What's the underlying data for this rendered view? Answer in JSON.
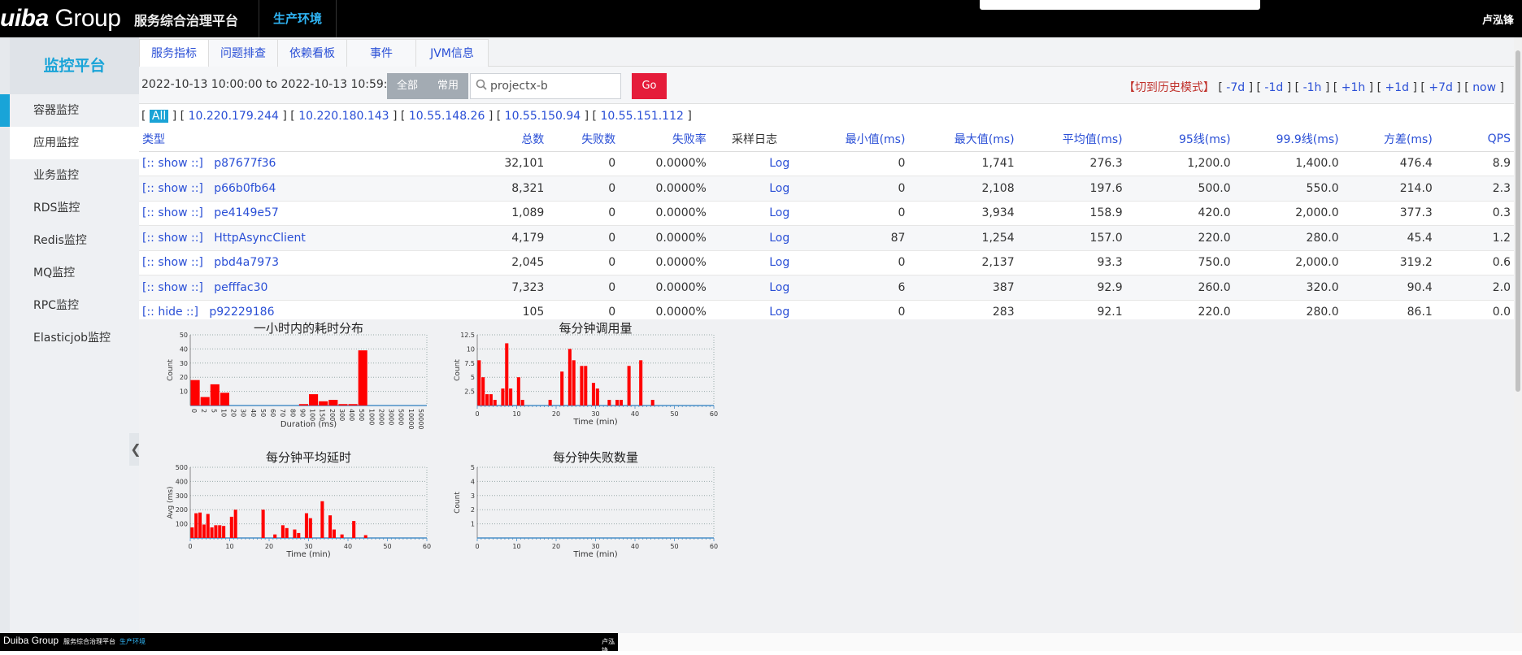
{
  "topbar": {
    "brand_prefix": "uiba",
    "brand_suffix": " Group",
    "app_title": "服务综合治理平台",
    "env_tab": "生产环境",
    "user": "卢泓锋"
  },
  "sidebar": {
    "title": "监控平台",
    "items": [
      {
        "label": "容器监控"
      },
      {
        "label": "应用监控",
        "active": true
      },
      {
        "label": "业务监控"
      },
      {
        "label": "RDS监控"
      },
      {
        "label": "Redis监控"
      },
      {
        "label": "MQ监控"
      },
      {
        "label": "RPC监控"
      },
      {
        "label": "Elasticjob监控"
      }
    ]
  },
  "tabs": [
    {
      "label": "服务指标",
      "active": true
    },
    {
      "label": "问题排查"
    },
    {
      "label": "依赖看板"
    },
    {
      "label": "事件"
    },
    {
      "label": "JVM信息"
    }
  ],
  "toolbar": {
    "time_range": "2022-10-13 10:00:00 to 2022-10-13 10:59:59",
    "seg_all": "全部",
    "seg_common": "常用",
    "search_value": "projectx-b",
    "go_label": "Go",
    "history_mode": "【切到历史模式】",
    "nav": [
      "-7d",
      "-1d",
      "-1h",
      "+1h",
      "+1d",
      "+7d",
      "now"
    ]
  },
  "ip_bar": {
    "all_label": "All",
    "ips": [
      "10.220.179.244",
      "10.220.180.143",
      "10.55.148.26",
      "10.55.150.94",
      "10.55.151.112"
    ]
  },
  "table": {
    "headers": [
      "类型",
      "总数",
      "失败数",
      "失败率",
      "采样日志",
      "最小值(ms)",
      "最大值(ms)",
      "平均值(ms)",
      "95线(ms)",
      "99.9线(ms)",
      "方差(ms)",
      "QPS"
    ],
    "rows": [
      {
        "toggle": "[:: show ::]",
        "name": "p87677f36",
        "total": "32,101",
        "fail": "0",
        "rate": "0.0000%",
        "log": "Log",
        "min": "0",
        "max": "1,741",
        "avg": "276.3",
        "p95": "1,200.0",
        "p999": "1,400.0",
        "std": "476.4",
        "qps": "8.9"
      },
      {
        "toggle": "[:: show ::]",
        "name": "p66b0fb64",
        "total": "8,321",
        "fail": "0",
        "rate": "0.0000%",
        "log": "Log",
        "min": "0",
        "max": "2,108",
        "avg": "197.6",
        "p95": "500.0",
        "p999": "550.0",
        "std": "214.0",
        "qps": "2.3"
      },
      {
        "toggle": "[:: show ::]",
        "name": "pe4149e57",
        "total": "1,089",
        "fail": "0",
        "rate": "0.0000%",
        "log": "Log",
        "min": "0",
        "max": "3,934",
        "avg": "158.9",
        "p95": "420.0",
        "p999": "2,000.0",
        "std": "377.3",
        "qps": "0.3"
      },
      {
        "toggle": "[:: show ::]",
        "name": "HttpAsyncClient",
        "total": "4,179",
        "fail": "0",
        "rate": "0.0000%",
        "log": "Log",
        "min": "87",
        "max": "1,254",
        "avg": "157.0",
        "p95": "220.0",
        "p999": "280.0",
        "std": "45.4",
        "qps": "1.2"
      },
      {
        "toggle": "[:: show ::]",
        "name": "pbd4a7973",
        "total": "2,045",
        "fail": "0",
        "rate": "0.0000%",
        "log": "Log",
        "min": "0",
        "max": "2,137",
        "avg": "93.3",
        "p95": "750.0",
        "p999": "2,000.0",
        "std": "319.2",
        "qps": "0.6"
      },
      {
        "toggle": "[:: show ::]",
        "name": "pefffac30",
        "total": "7,323",
        "fail": "0",
        "rate": "0.0000%",
        "log": "Log",
        "min": "6",
        "max": "387",
        "avg": "92.9",
        "p95": "260.0",
        "p999": "320.0",
        "std": "90.4",
        "qps": "2.0"
      },
      {
        "toggle": "[:: hide ::]",
        "name": "p92229186",
        "total": "105",
        "fail": "0",
        "rate": "0.0000%",
        "log": "Log",
        "min": "0",
        "max": "283",
        "avg": "92.1",
        "p95": "220.0",
        "p999": "280.0",
        "std": "86.1",
        "qps": "0.0"
      }
    ]
  },
  "chart_data": [
    {
      "type": "bar",
      "title": "一小时内的耗时分布",
      "xlabel": "Duration (ms)",
      "ylabel": "Count",
      "ylim": [
        0,
        50
      ],
      "yticks": [
        10,
        20,
        30,
        40,
        50
      ],
      "categories": [
        "0",
        "1",
        "2",
        "3",
        "4",
        "5",
        "6",
        "7",
        "8",
        "9",
        "10",
        "11",
        "12",
        "13",
        "14",
        "15",
        "16",
        "17",
        "18",
        "19",
        "20",
        "21",
        "22",
        "23"
      ],
      "tick_labels": [
        "0",
        "2",
        "5",
        "10",
        "20",
        "30",
        "40",
        "50",
        "60",
        "70",
        "80",
        "90",
        "100",
        "150",
        "200",
        "300",
        "400",
        "500",
        "1000",
        "2000",
        "3000",
        "5000",
        "10000",
        "50000"
      ],
      "values": [
        18,
        6,
        15,
        9,
        0,
        0,
        0,
        0,
        0,
        0,
        0,
        1,
        8,
        3,
        4,
        1,
        1,
        39,
        0,
        0,
        0,
        0,
        0,
        0
      ],
      "color": "#ff0000",
      "grid": true
    },
    {
      "type": "bar",
      "title": "每分钟调用量",
      "xlabel": "Time (min)",
      "ylabel": "Count",
      "xlim": [
        0,
        60
      ],
      "ylim": [
        0,
        12.5
      ],
      "yticks": [
        2.5,
        5,
        7.5,
        10,
        12.5
      ],
      "xticks": [
        0,
        10,
        20,
        30,
        40,
        50,
        60
      ],
      "x": [
        0,
        1,
        2,
        3,
        4,
        6,
        7,
        8,
        10,
        11,
        18,
        21,
        23,
        24,
        26,
        27,
        29,
        30,
        33,
        35,
        36,
        38,
        41,
        44
      ],
      "values": [
        8,
        5,
        2,
        2,
        1,
        3,
        11,
        3,
        5,
        1,
        1,
        6,
        10,
        8,
        7,
        7,
        4,
        3,
        1,
        1,
        1,
        7,
        8,
        1
      ],
      "color": "#ff0000",
      "grid": true
    },
    {
      "type": "bar",
      "title": "每分钟平均延时",
      "xlabel": "Time (min)",
      "ylabel": "Avg (ms)",
      "xlim": [
        0,
        60
      ],
      "ylim": [
        0,
        500
      ],
      "yticks": [
        100,
        200,
        300,
        400,
        500
      ],
      "xticks": [
        0,
        10,
        20,
        30,
        40,
        50,
        60
      ],
      "x": [
        0,
        1,
        2,
        3,
        4,
        5,
        6,
        7,
        8,
        10,
        11,
        18,
        21,
        23,
        24,
        26,
        27,
        29,
        30,
        33,
        35,
        36,
        38,
        41,
        44
      ],
      "values": [
        75,
        175,
        180,
        95,
        170,
        75,
        90,
        90,
        85,
        150,
        200,
        200,
        25,
        90,
        70,
        60,
        35,
        175,
        140,
        260,
        160,
        60,
        25,
        120,
        20
      ],
      "color": "#ff0000",
      "grid": true
    },
    {
      "type": "bar",
      "title": "每分钟失败数量",
      "xlabel": "Time (min)",
      "ylabel": "Count",
      "xlim": [
        0,
        60
      ],
      "ylim": [
        0,
        5
      ],
      "yticks": [
        1,
        2,
        3,
        4,
        5
      ],
      "xticks": [
        0,
        10,
        20,
        30,
        40,
        50,
        60
      ],
      "x": [],
      "values": [],
      "color": "#ff0000",
      "grid": true
    }
  ],
  "bottombar": {
    "brand": "Duiba Group",
    "app_title": "服务综合治理平台",
    "env": "生产环境",
    "user": "卢泓锋"
  }
}
